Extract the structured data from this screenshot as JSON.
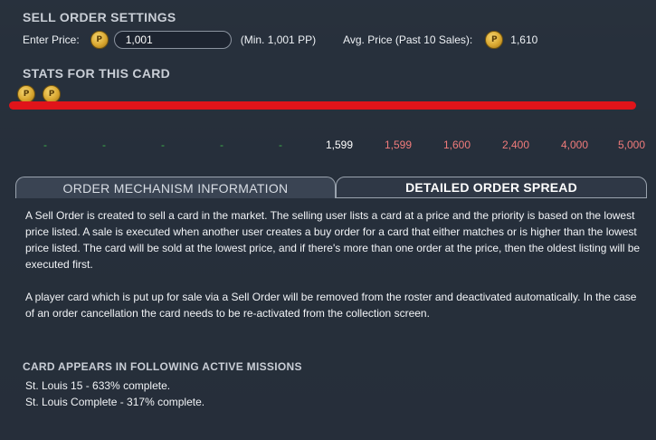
{
  "sell_order": {
    "title": "SELL ORDER SETTINGS",
    "enter_price_label": "Enter Price:",
    "price_value": "1,001",
    "min_note": "(Min. 1,001 PP)",
    "avg_label": "Avg. Price (Past 10 Sales):",
    "avg_value": "1,610"
  },
  "stats": {
    "title": "STATS FOR THIS CARD"
  },
  "spread": {
    "values": [
      "-",
      "-",
      "-",
      "-",
      "-",
      "1,599",
      "1,599",
      "1,600",
      "2,400",
      "4,000",
      "5,000"
    ],
    "colors": {
      "dash": "#3fb24a",
      "neutral": "#ffffff",
      "sell": "#f07b7b"
    }
  },
  "tabs": {
    "left_label": "ORDER MECHANISM INFORMATION",
    "right_label": "DETAILED ORDER SPREAD"
  },
  "info": {
    "paragraph1": "A Sell Order is created to sell a card in the market. The selling user lists a card at a price and the priority is based on the lowest price listed. A sale is executed when another user creates a buy order for a card that either matches or is higher than the lowest price listed. The card will be sold at the lowest price, and if there's more than one order at the price, then the oldest listing will be executed first.",
    "paragraph2": "A player card which is put up for sale via a Sell Order will be removed from the roster and deactivated automatically. In the case of an order cancellation the card needs to be re-activated from the collection screen."
  },
  "missions": {
    "title": "CARD APPEARS IN FOLLOWING ACTIVE MISSIONS",
    "items": [
      "St. Louis 15 - 633% complete.",
      "St. Louis Complete - 317% complete."
    ]
  },
  "icons": {
    "coin": "pp-coin-icon"
  }
}
